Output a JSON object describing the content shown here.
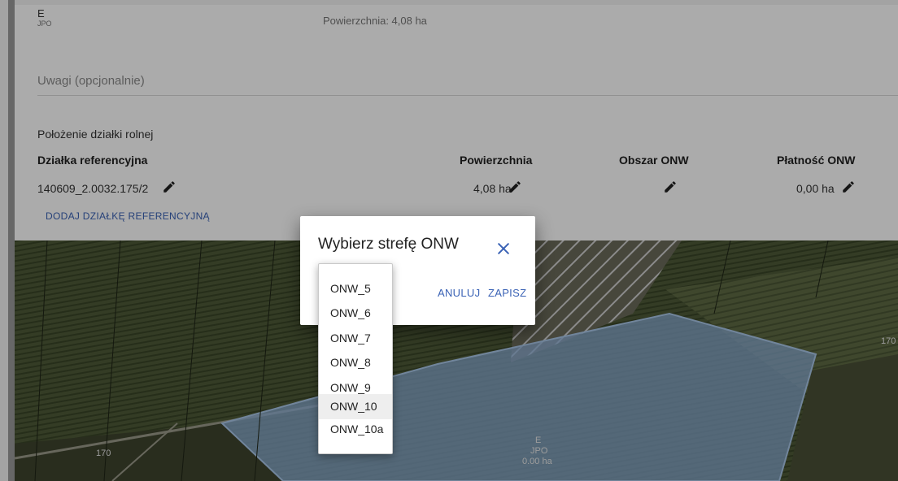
{
  "header": {
    "code": "E",
    "code_sub": "JPO",
    "area_text": "Powierzchnia: 4,08 ha"
  },
  "notes": {
    "placeholder": "Uwagi (opcjonalnie)"
  },
  "location": {
    "title": "Położenie działki rolnej",
    "columns": [
      "Działka referencyjna",
      "Powierzchnia",
      "Obszar ONW",
      "Płatność ONW"
    ],
    "row": {
      "parcel_id": "140609_2.0032.175/2",
      "area": "4,08 ha",
      "onw_area": "",
      "onw_payment": "0,00 ha"
    },
    "add_link": "DODAJ DZIAŁKĘ REFERENCYJNĄ"
  },
  "map": {
    "labels": {
      "left": "170",
      "right": "170",
      "parcel_code": "E",
      "parcel_sub": "JPO",
      "parcel_area": "0.00 ha"
    },
    "parcel_color": "#8fb3dc"
  },
  "dialog": {
    "title": "Wybierz strefę ONW",
    "cancel": "ANULUJ",
    "save": "ZAPISZ",
    "options": [
      "ONW_5",
      "ONW_6",
      "ONW_7",
      "ONW_8",
      "ONW_9",
      "ONW_10",
      "ONW_10a"
    ],
    "highlighted": "ONW_10"
  },
  "colors": {
    "link": "#3a62b5"
  },
  "icons": {
    "edit": "pencil-icon",
    "close": "close-icon"
  }
}
